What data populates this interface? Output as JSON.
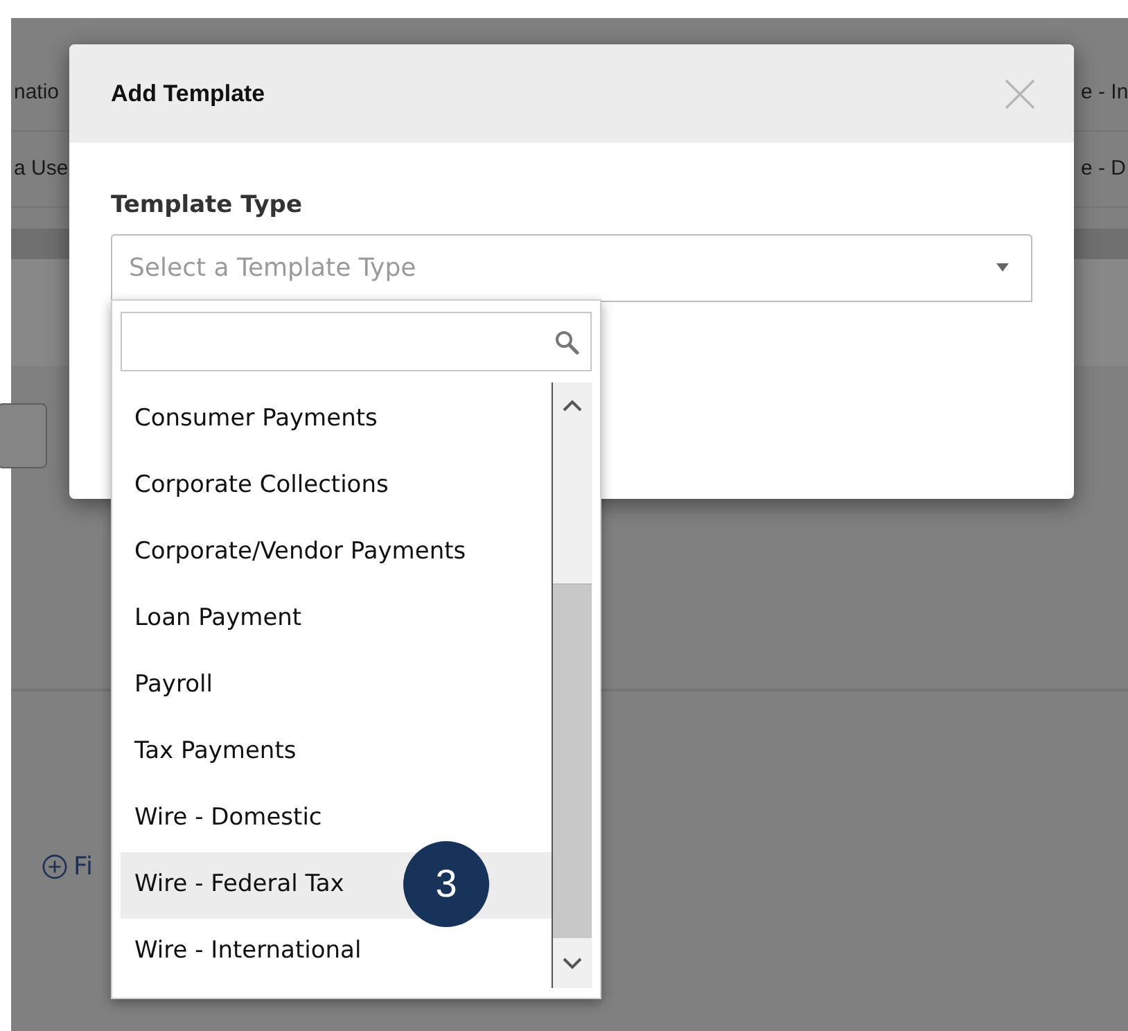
{
  "background": {
    "rows": [
      {
        "left": "natio",
        "right": "e - In"
      },
      {
        "left": "a Use",
        "right": "e - D"
      }
    ],
    "link": "Fi"
  },
  "dialog": {
    "title": "Add Template",
    "field_label": "Template Type",
    "select": {
      "placeholder": "Select a Template Type",
      "expanded": true
    }
  },
  "dropdown": {
    "options": [
      {
        "label": "Consumer Payments",
        "selected": false
      },
      {
        "label": "Corporate Collections",
        "selected": false
      },
      {
        "label": "Corporate/Vendor Payments",
        "selected": false
      },
      {
        "label": "Loan Payment",
        "selected": false
      },
      {
        "label": "Payroll",
        "selected": false
      },
      {
        "label": "Tax Payments",
        "selected": false
      },
      {
        "label": "Wire - Domestic",
        "selected": false
      },
      {
        "label": "Wire - Federal Tax",
        "selected": true
      },
      {
        "label": "Wire - International",
        "selected": false
      }
    ]
  },
  "callout": {
    "number": "3"
  }
}
